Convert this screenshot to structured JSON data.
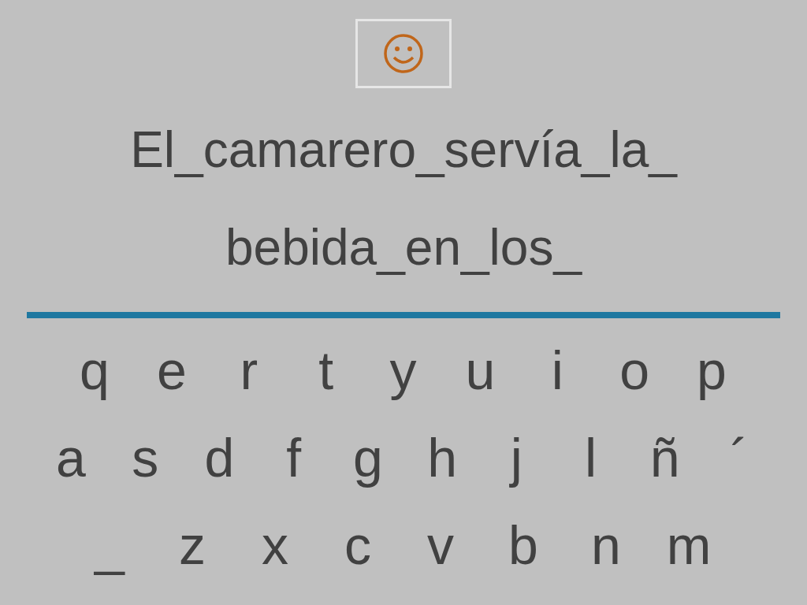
{
  "sentence_lines": [
    "El_camarero_servía_la_",
    "bebida_en_los_"
  ],
  "keyboard_rows": [
    [
      "q",
      "e",
      "r",
      "t",
      "y",
      "u",
      "i",
      "o",
      "p"
    ],
    [
      "a",
      "s",
      "d",
      "f",
      "g",
      "h",
      "j",
      "l",
      "ñ",
      "´"
    ],
    [
      "_",
      "z",
      "x",
      "c",
      "v",
      "b",
      "n",
      "m"
    ]
  ]
}
